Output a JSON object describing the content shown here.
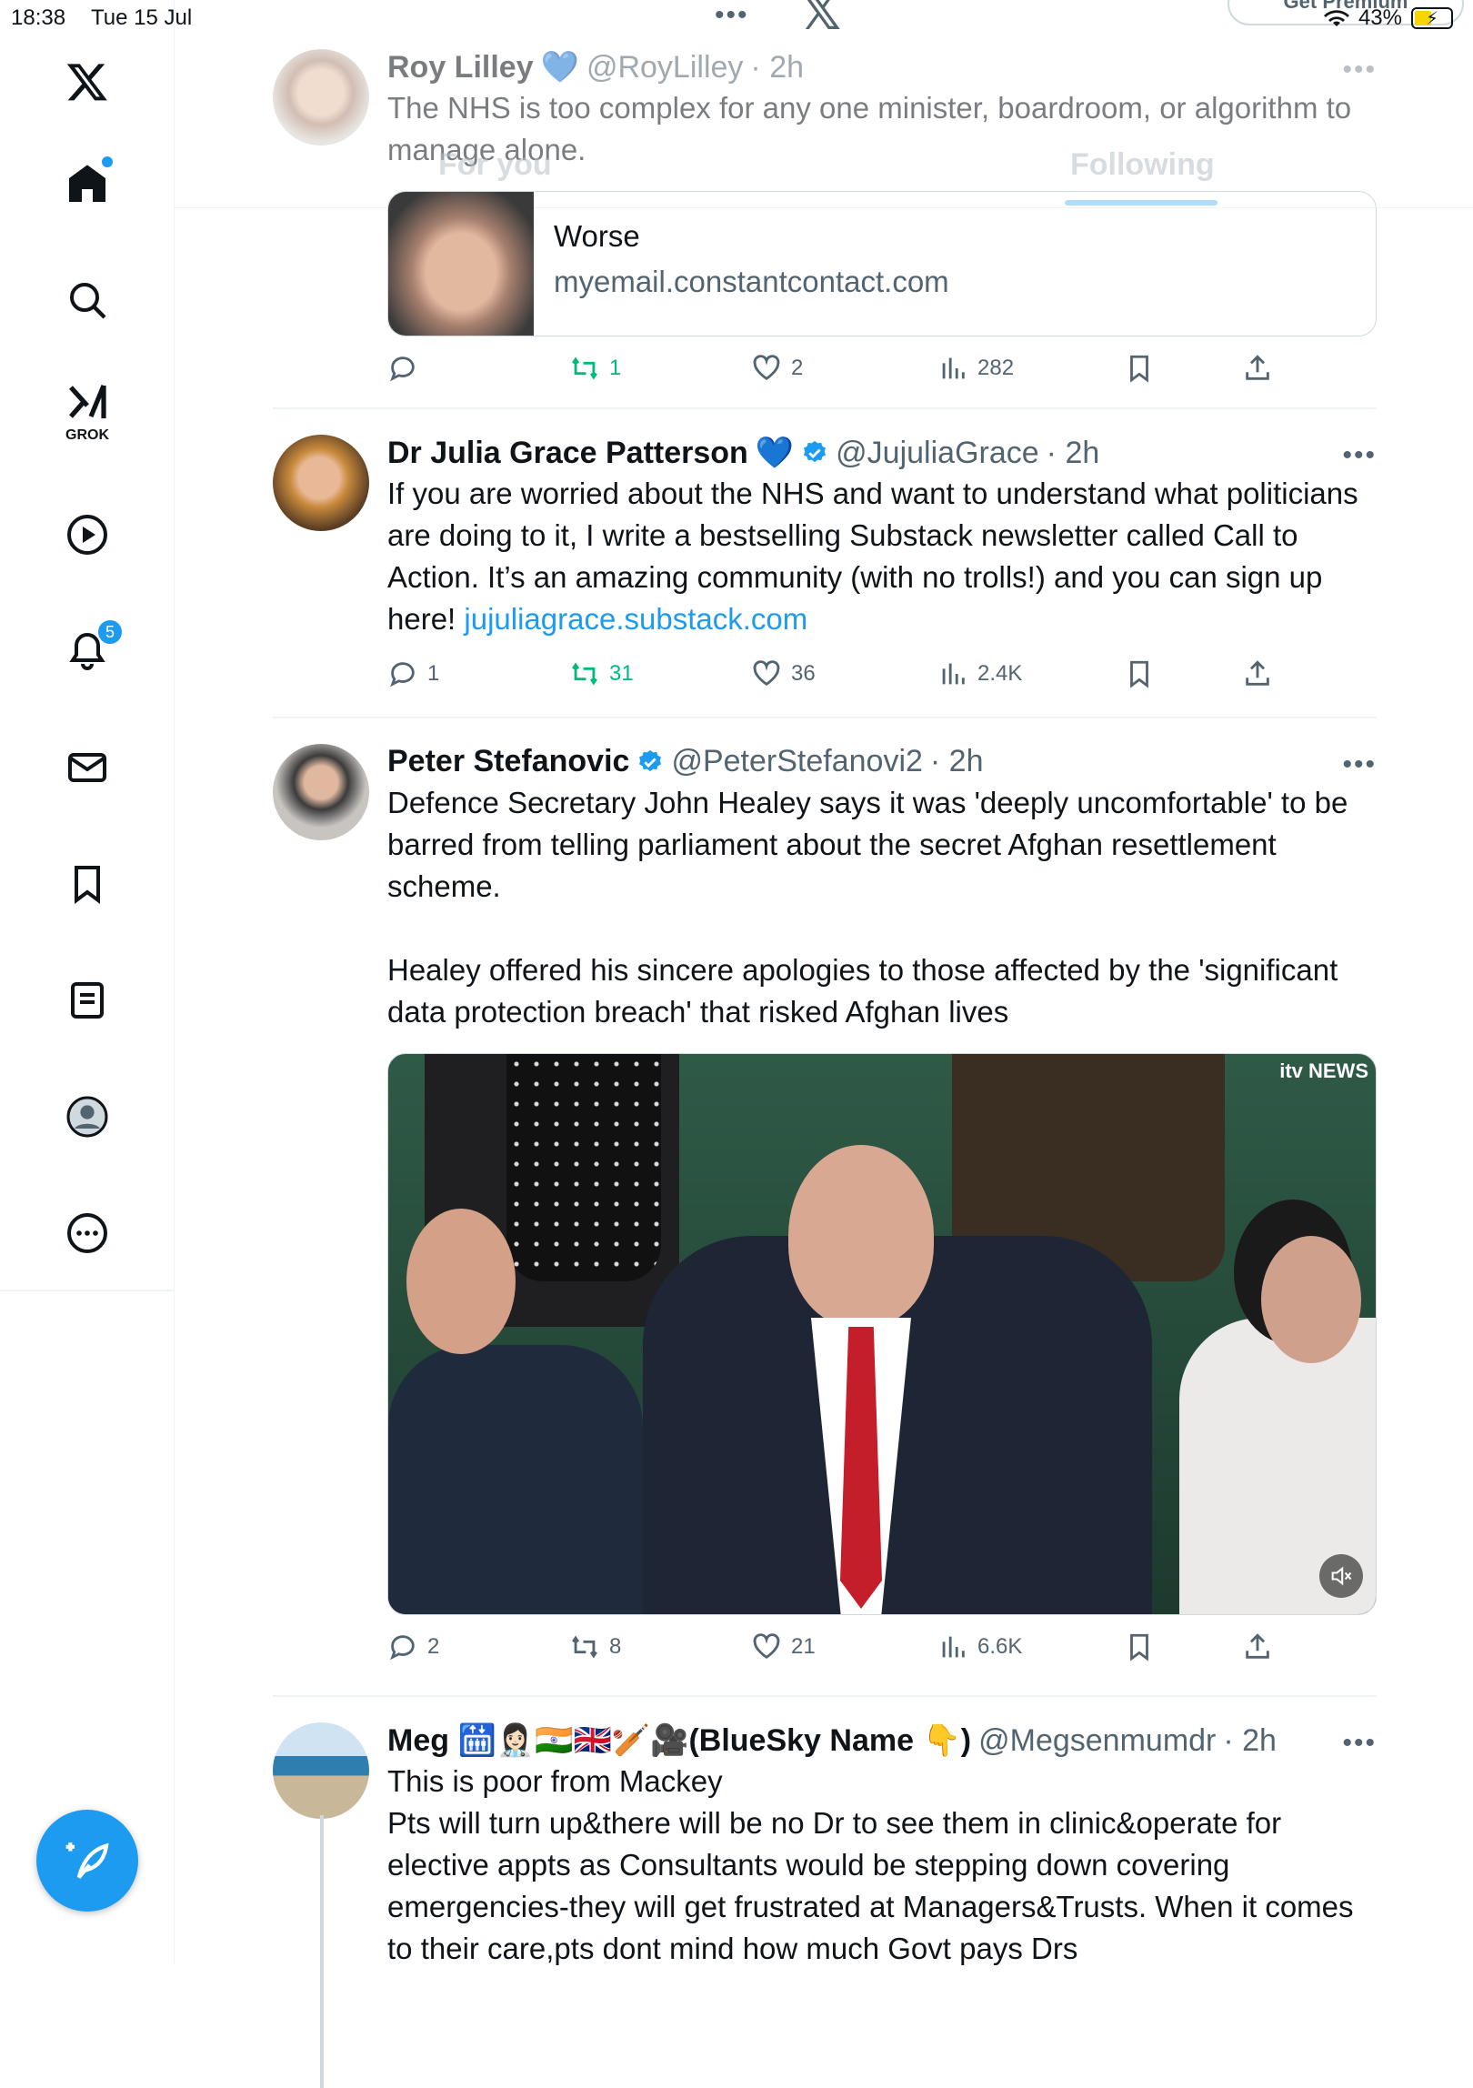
{
  "status_bar": {
    "time": "18:38",
    "date": "Tue 15 Jul",
    "battery": "43%"
  },
  "header": {
    "more_dots": "•••",
    "logo": "𝕏",
    "premium_label": "Get Premium"
  },
  "tabs": [
    {
      "label": "For you"
    },
    {
      "label": "Following"
    }
  ],
  "sidebar": {
    "items": [
      {
        "name": "x-logo-icon"
      },
      {
        "name": "home-icon"
      },
      {
        "name": "search-icon"
      },
      {
        "name": "grok-icon",
        "label": "GROK"
      },
      {
        "name": "video-icon"
      },
      {
        "name": "notifications-icon",
        "badge": "5"
      },
      {
        "name": "messages-icon"
      },
      {
        "name": "bookmarks-icon"
      },
      {
        "name": "lists-icon"
      },
      {
        "name": "profile-icon"
      },
      {
        "name": "more-icon"
      }
    ],
    "compose_icon": "compose-icon"
  },
  "posts": [
    {
      "name": "Roy Lilley",
      "badge": "💙",
      "handle": "@RoyLilley",
      "time": "· 2h",
      "text": "The NHS is too complex for any one minister, boardroom, or algorithm to manage alone.",
      "card": {
        "title": "Worse",
        "domain": "myemail.constantcontact.com"
      },
      "replies": "",
      "reposts": "1",
      "likes": "2",
      "views": "282"
    },
    {
      "name": "Dr Julia Grace Patterson",
      "badge": "💙",
      "handle": "@JujuliaGrace",
      "time": "· 2h",
      "text": "If you are worried about the NHS and want to understand what politicians are doing to it, I write a bestselling Substack newsletter called Call to Action. It’s an amazing community (with no trolls!) and you can sign up here! ",
      "link": "jujuliagrace.substack.com",
      "replies": "1",
      "reposts": "31",
      "likes": "36",
      "views": "2.4K"
    },
    {
      "name": "Peter Stefanovic",
      "handle": "@PeterStefanovi2",
      "time": "· 2h",
      "text": "Defence Secretary John Healey says it was 'deeply uncomfortable' to be barred from telling parliament about the secret Afghan resettlement scheme.\n\nHealey offered his sincere apologies to those affected by the 'significant data protection breach' that risked Afghan lives",
      "media_watermark": "itv NEWS",
      "replies": "2",
      "reposts": "8",
      "likes": "21",
      "views": "6.6K"
    },
    {
      "name": "Meg 🛗👩🏻‍⚕️🇮🇳🇬🇧🏏🎥(BlueSky Name 👇)",
      "handle": "@Megsenmumdr",
      "time": "· 2h",
      "text": "This is poor from Mackey\nPts will turn up&there will be no Dr to see them in clinic&operate for elective appts as Consultants would be stepping down covering emergencies-they will get frustrated at Managers&Trusts. When it comes to their care,pts dont mind how much Govt pays Drs"
    }
  ]
}
